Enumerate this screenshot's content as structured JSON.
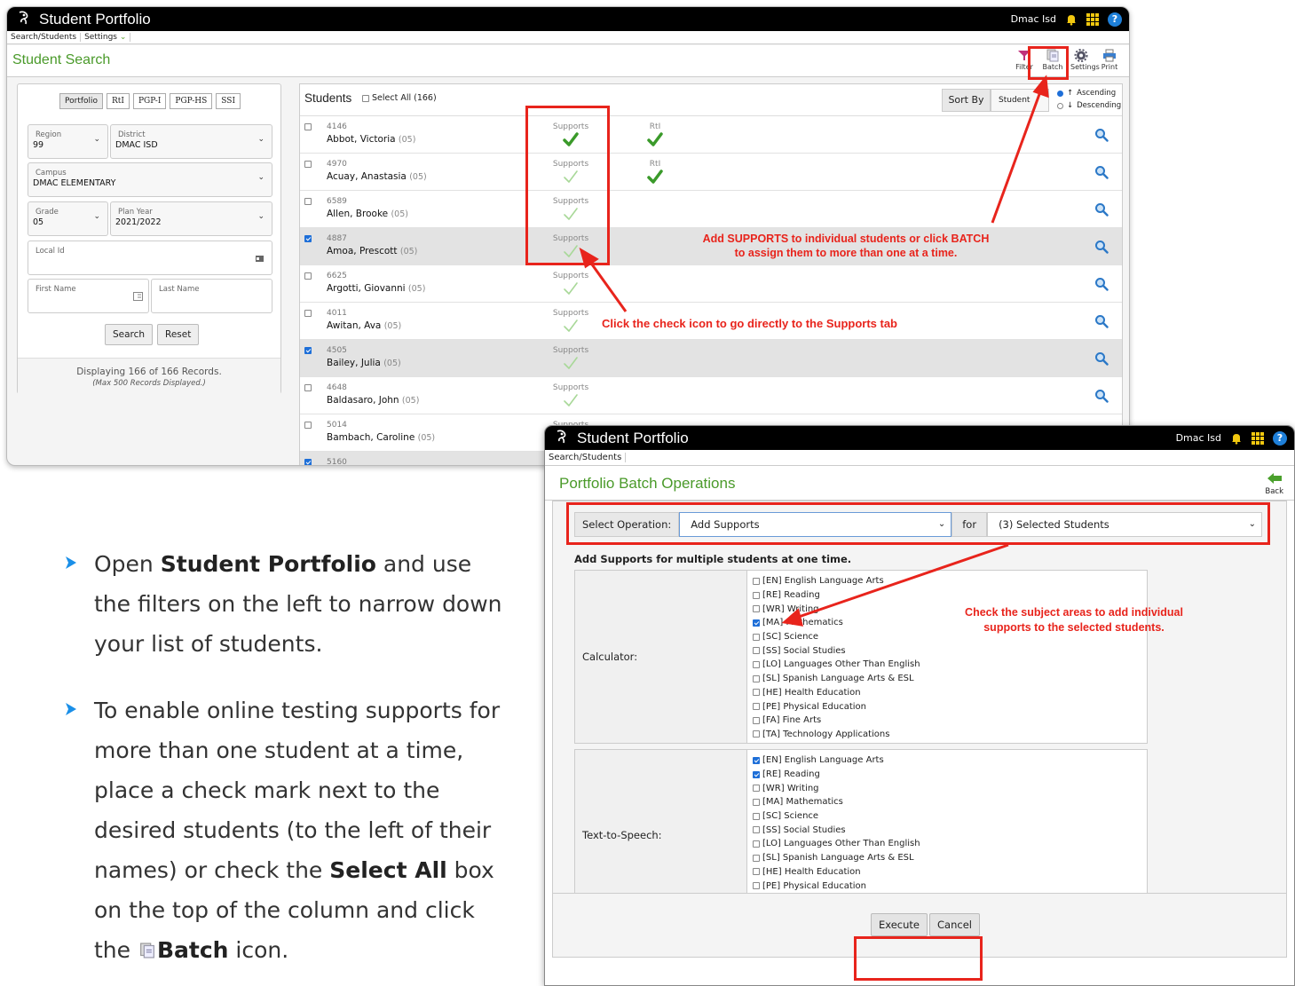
{
  "win1": {
    "app_title": "Student Portfolio",
    "user": "Dmac Isd",
    "menu": {
      "search_students": "Search/Students",
      "settings": "Settings"
    },
    "page_title": "Student Search",
    "tools": [
      {
        "label": "Filter",
        "icon": "filter-icon"
      },
      {
        "label": "Batch",
        "icon": "batch-icon"
      },
      {
        "label": "Settings",
        "icon": "gear-icon"
      },
      {
        "label": "Print",
        "icon": "print-icon"
      }
    ],
    "filter_tabs": [
      "Portfolio",
      "RtI",
      "PGP-I",
      "PGP-HS",
      "SSI"
    ],
    "filters": {
      "region_label": "Region",
      "region_value": "99",
      "district_label": "District",
      "district_value": "DMAC ISD",
      "campus_label": "Campus",
      "campus_value": "DMAC ELEMENTARY",
      "grade_label": "Grade",
      "grade_value": "05",
      "planyear_label": "Plan Year",
      "planyear_value": "2021/2022",
      "localid_label": "Local Id",
      "firstname_label": "First Name",
      "lastname_label": "Last Name",
      "search_btn": "Search",
      "reset_btn": "Reset",
      "display_text": "Displaying 166 of 166 Records.",
      "max_text": "(Max 500 Records Displayed.)"
    },
    "students": {
      "title": "Students",
      "select_all": "Select All (166)",
      "sort_by": "Sort By",
      "sort_value": "Student",
      "ascending": "Ascending",
      "descending": "Descending",
      "supports_label": "Supports",
      "rti_label": "RtI",
      "rows": [
        {
          "id": "4146",
          "name": "Abbot, Victoria",
          "grade": "(05)",
          "checked": false,
          "rti": true,
          "supports_filled": true
        },
        {
          "id": "4970",
          "name": "Acuay, Anastasia",
          "grade": "(05)",
          "checked": false,
          "rti": true,
          "supports_filled": false
        },
        {
          "id": "6589",
          "name": "Allen, Brooke",
          "grade": "(05)",
          "checked": false,
          "rti": false,
          "supports_filled": false
        },
        {
          "id": "4887",
          "name": "Amoa, Prescott",
          "grade": "(05)",
          "checked": true,
          "rti": false,
          "supports_filled": false
        },
        {
          "id": "6625",
          "name": "Argotti, Giovanni",
          "grade": "(05)",
          "checked": false,
          "rti": false,
          "supports_filled": false
        },
        {
          "id": "4011",
          "name": "Awitan, Ava",
          "grade": "(05)",
          "checked": false,
          "rti": false,
          "supports_filled": false
        },
        {
          "id": "4505",
          "name": "Bailey, Julia",
          "grade": "(05)",
          "checked": true,
          "rti": false,
          "supports_filled": false
        },
        {
          "id": "4648",
          "name": "Baldasaro, John",
          "grade": "(05)",
          "checked": false,
          "rti": false,
          "supports_filled": false
        },
        {
          "id": "5014",
          "name": "Bambach, Caroline",
          "grade": "(05)",
          "checked": false,
          "rti": false,
          "supports_filled": false
        },
        {
          "id": "5160",
          "name": "",
          "grade": "",
          "checked": true,
          "rti": false,
          "supports_filled": false
        }
      ]
    },
    "annotations": {
      "batch_note_1": "Add SUPPORTS to individual students or click BATCH",
      "batch_note_2": "to assign them to more than one at a time.",
      "check_note": "Click the check icon to go directly to the Supports tab"
    }
  },
  "win2": {
    "app_title": "Student Portfolio",
    "user": "Dmac Isd",
    "menu": {
      "search_students": "Search/Students"
    },
    "page_title": "Portfolio Batch Operations",
    "back": "Back",
    "select_operation_label": "Select Operation:",
    "operation_value": "Add Supports",
    "for_label": "for",
    "for_value": "(3) Selected Students",
    "add_title": "Add Supports for multiple students at one time.",
    "calculator_label": "Calculator:",
    "tts_label": "Text-to-Speech:",
    "subjects": [
      "[EN] English Language Arts",
      "[RE] Reading",
      "[WR] Writing",
      "[MA] Mathematics",
      "[SC] Science",
      "[SS] Social Studies",
      "[LO] Languages Other Than English",
      "[SL] Spanish Language Arts & ESL",
      "[HE] Health Education",
      "[PE] Physical Education",
      "[FA] Fine Arts",
      "[TA] Technology Applications"
    ],
    "calculator_checked": [
      false,
      false,
      false,
      true,
      false,
      false,
      false,
      false,
      false,
      false,
      false,
      false
    ],
    "tts_checked": [
      true,
      true,
      false,
      false,
      false,
      false,
      false,
      false,
      false,
      false,
      false,
      false
    ],
    "execute_btn": "Execute",
    "cancel_btn": "Cancel",
    "annotation_1": "Check the subject areas to add individual",
    "annotation_2": "supports to the selected students."
  },
  "instructions": {
    "item1_a": "Open ",
    "item1_b": "Student Portfolio",
    "item1_c": " and use the filters on the left to narrow down your list of students.",
    "item2_a": "To enable online testing supports for more than one student at a time, place a check mark next to the desired students (to the left of their names) or check the ",
    "item2_b": "Select All",
    "item2_c": " box on the top of the column and click the ",
    "item2_d": "Batch",
    "item2_e": " icon."
  },
  "colors": {
    "accent_green": "#4a9a2a",
    "annotation_red": "#e8241c",
    "bullet_blue": "#1a8fe8",
    "check_green": "#3a9a2a"
  }
}
